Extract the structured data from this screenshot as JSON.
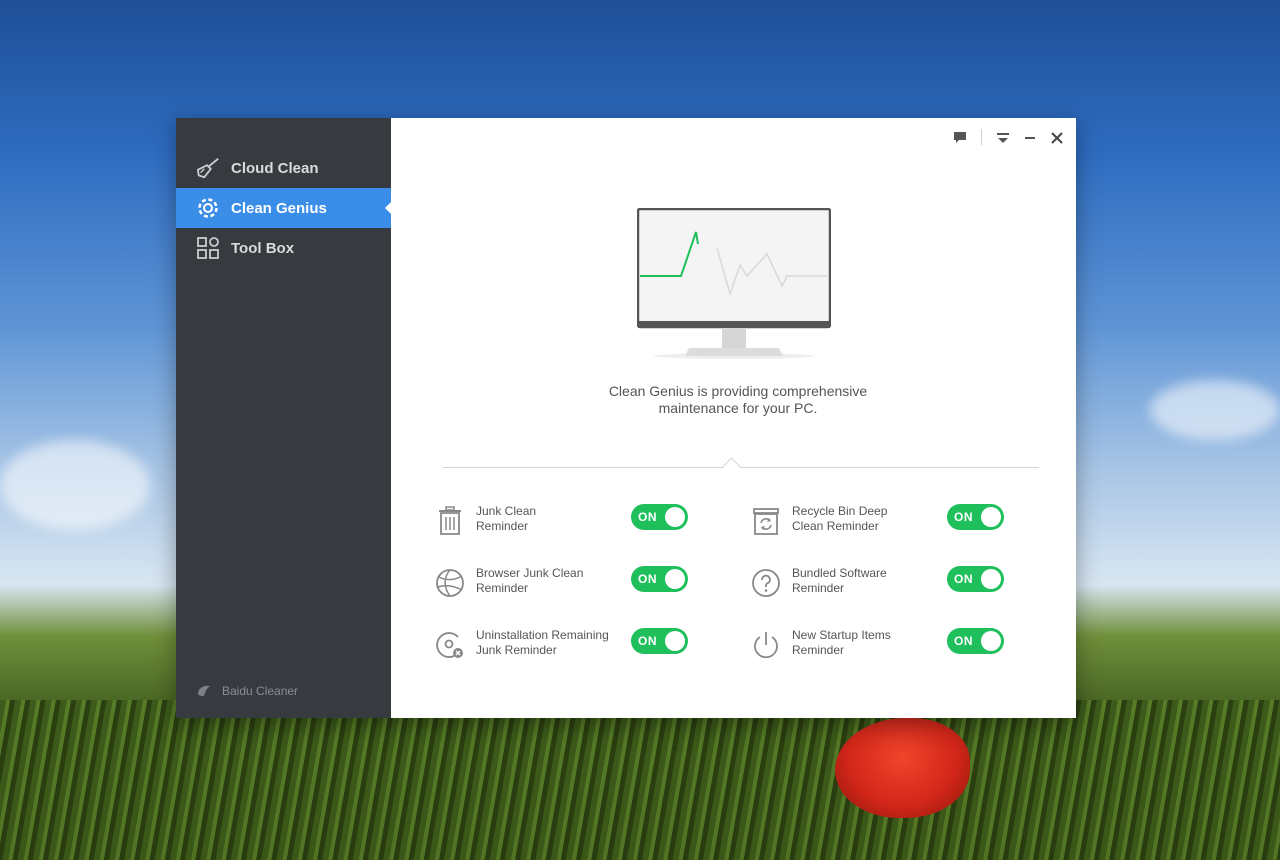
{
  "sidebar": {
    "items": [
      {
        "label": "Cloud Clean",
        "icon": "broom-icon",
        "active": false
      },
      {
        "label": "Clean Genius",
        "icon": "gear-icon",
        "active": true
      },
      {
        "label": "Tool Box",
        "icon": "toolbox-grid-icon",
        "active": false
      }
    ],
    "brand": "Baidu Cleaner"
  },
  "window_controls": [
    "feedback-icon",
    "menu-icon",
    "minimize-icon",
    "close-icon"
  ],
  "main": {
    "description_line1": "Clean Genius is providing comprehensive",
    "description_line2": "maintenance for your PC.",
    "settings": [
      {
        "line1": "Junk Clean",
        "line2": "Reminder",
        "icon": "trash-icon",
        "toggle": "ON"
      },
      {
        "line1": "Recycle Bin Deep",
        "line2": "Clean Reminder",
        "icon": "recycle-bin-icon",
        "toggle": "ON"
      },
      {
        "line1": "Browser Junk Clean",
        "line2": "Reminder",
        "icon": "browser-icon",
        "toggle": "ON"
      },
      {
        "line1": "Bundled Software",
        "line2": "Reminder",
        "icon": "question-icon",
        "toggle": "ON"
      },
      {
        "line1": "Uninstallation Remaining",
        "line2": "Junk Reminder",
        "icon": "uninstall-disc-icon",
        "toggle": "ON"
      },
      {
        "line1": "New Startup Items",
        "line2": "Reminder",
        "icon": "power-icon",
        "toggle": "ON"
      }
    ]
  },
  "colors": {
    "sidebar_bg": "#373b40",
    "active_item": "#3b8ee8",
    "toggle_on": "#1fbf5c",
    "heartbeat": "#1fbf5c"
  }
}
